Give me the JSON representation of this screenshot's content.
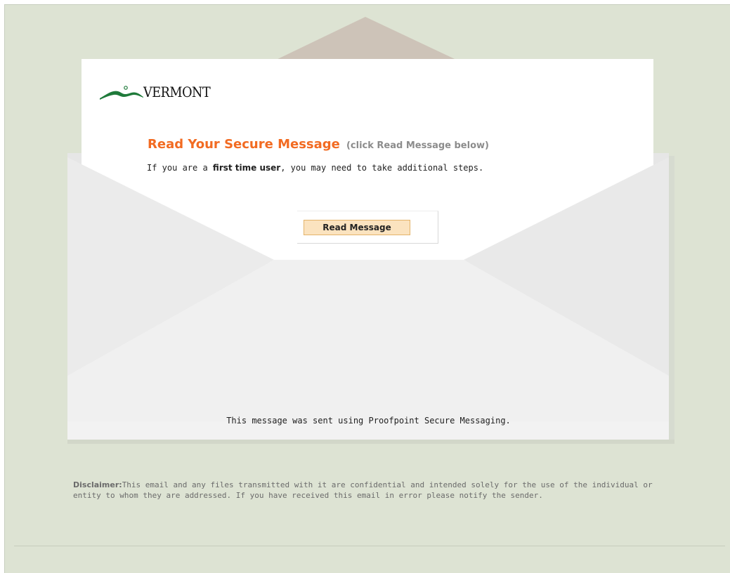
{
  "brand": {
    "logo_text": "VERMONT",
    "accent_color": "#f26b22",
    "logo_color": "#1f7a3a"
  },
  "message": {
    "title": "Read Your Secure Message",
    "title_hint": "(click Read Message below)",
    "subtitle_prefix": "If you are a ",
    "subtitle_bold": "first time user",
    "subtitle_suffix": ", you may need to take additional steps.",
    "button_label": "Read Message",
    "footer": "This message was sent using Proofpoint Secure Messaging."
  },
  "disclaimer": {
    "label": "Disclaimer:",
    "text": "This email and any files transmitted with it are confidential and intended solely for the use of the individual or entity to whom they are addressed. If you have received this email in error please notify the sender."
  }
}
